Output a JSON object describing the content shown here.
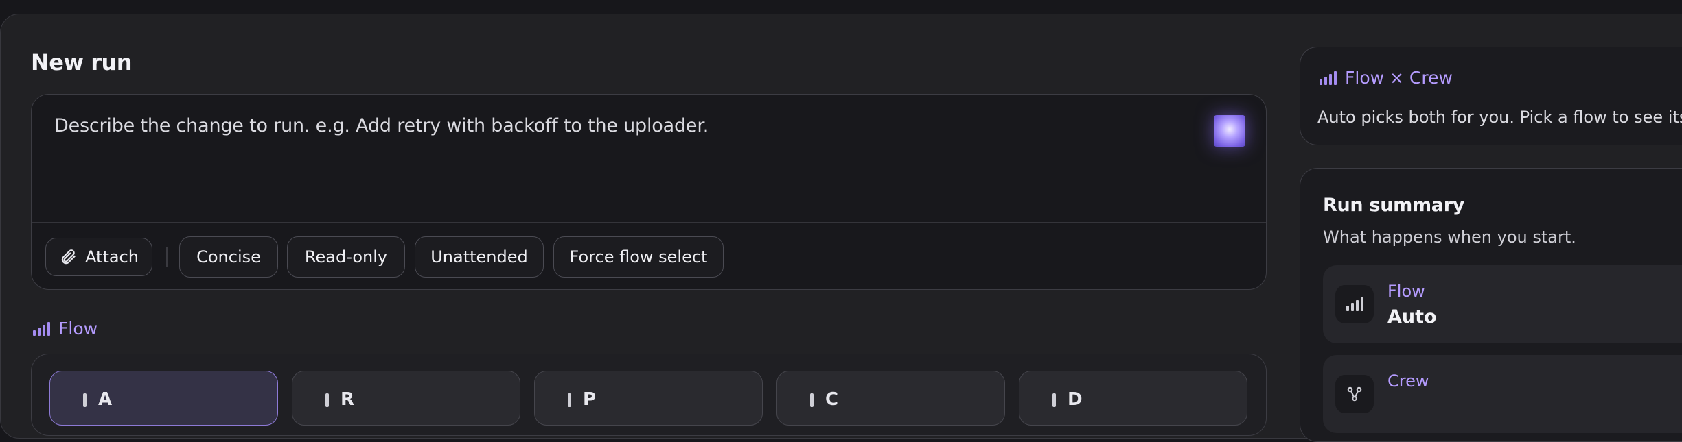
{
  "page": {
    "title": "New run"
  },
  "composer": {
    "placeholder": "Describe the change to run. e.g. Add retry with backoff to the uploader.",
    "chips": {
      "attach": "Attach",
      "concise": "Concise",
      "read_only": "Read-only",
      "unattended": "Unattended",
      "force_flow_select": "Force flow select"
    }
  },
  "flow_section": {
    "label": "Flow",
    "cards": [
      "A",
      "R",
      "P",
      "C",
      "D"
    ]
  },
  "flow_crew_card": {
    "title": "Flow × Crew",
    "description": "Auto picks both for you. Pick a flow to see its sea"
  },
  "run_summary": {
    "title": "Run summary",
    "subtitle": "What happens when you start.",
    "rows": [
      {
        "key": "Flow",
        "value": "Auto",
        "icon": "bars-icon"
      },
      {
        "key": "Crew",
        "value": "",
        "icon": "crew-icon"
      }
    ]
  },
  "colors": {
    "accent": "#b59cff",
    "background": "#212124"
  }
}
